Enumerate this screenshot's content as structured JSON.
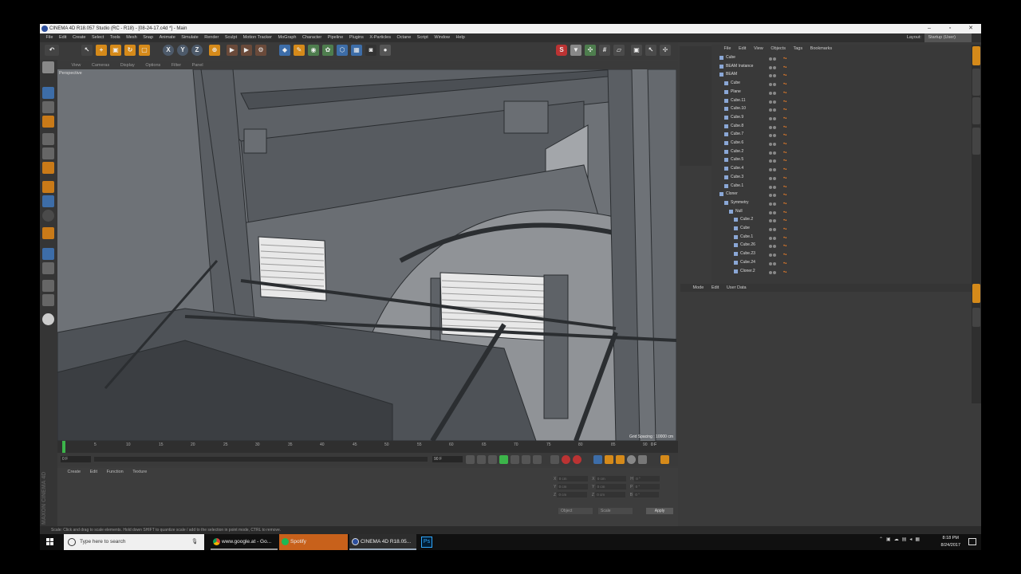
{
  "window": {
    "title": "CINEMA 4D R18.057 Studio (RC - R18) - [08-24-17.c4d *] - Main",
    "controls": [
      "–",
      "▫",
      "✕"
    ]
  },
  "menubar": {
    "items": [
      "File",
      "Edit",
      "Create",
      "Select",
      "Tools",
      "Mesh",
      "Snap",
      "Animate",
      "Simulate",
      "Render",
      "Sculpt",
      "Motion Tracker",
      "MoGraph",
      "Character",
      "Pipeline",
      "Plugins",
      "X-Particles",
      "Octane",
      "Script",
      "Window",
      "Help"
    ],
    "layout_label": "Layout:",
    "layout_value": "Startup (User)"
  },
  "toolbar": {
    "axis_labels": [
      "X",
      "Y",
      "Z"
    ]
  },
  "viewport": {
    "menu": [
      "View",
      "Cameras",
      "Display",
      "Options",
      "Filter",
      "Panel"
    ],
    "label": "Perspective",
    "grid_spacing": "Grid Spacing : 10000 cm"
  },
  "timeline": {
    "ticks": [
      "0",
      "5",
      "10",
      "15",
      "20",
      "25",
      "30",
      "35",
      "40",
      "45",
      "50",
      "55",
      "60",
      "65",
      "70",
      "75",
      "80",
      "85",
      "90"
    ],
    "current_frame": "0 F",
    "end_frame": "90 F",
    "frame_indicator": "0 F"
  },
  "material_manager": {
    "menu": [
      "Create",
      "Edit",
      "Function",
      "Texture"
    ]
  },
  "logo": {
    "text": "MAXON CINEMA 4D"
  },
  "coordinates": {
    "rows": [
      {
        "a": "X",
        "v1": "0 cm",
        "b": "X",
        "v2": "0 cm",
        "c": "H",
        "v3": "0 °"
      },
      {
        "a": "Y",
        "v1": "0 cm",
        "b": "Y",
        "v2": "0 cm",
        "c": "P",
        "v3": "0 °"
      },
      {
        "a": "Z",
        "v1": "0 cm",
        "b": "Z",
        "v2": "0 cm",
        "c": "B",
        "v3": "0 °"
      }
    ],
    "mode1": "Object",
    "mode2": "Scale",
    "apply": "Apply"
  },
  "statusbar": {
    "text": "Scale: Click and drag to scale elements. Hold down SHIFT to quantize scale / add to the selection in point mode, CTRL to remove."
  },
  "object_manager": {
    "menu": [
      "File",
      "Edit",
      "View",
      "Objects",
      "Tags",
      "Bookmarks"
    ],
    "objects": [
      {
        "name": "Cube",
        "indent": 1
      },
      {
        "name": "BEAM Instance",
        "indent": 1
      },
      {
        "name": "BEAM",
        "indent": 1
      },
      {
        "name": "Cube",
        "indent": 2
      },
      {
        "name": "Plane",
        "indent": 2
      },
      {
        "name": "Cube.11",
        "indent": 2
      },
      {
        "name": "Cube.10",
        "indent": 2
      },
      {
        "name": "Cube.9",
        "indent": 2
      },
      {
        "name": "Cube.8",
        "indent": 2
      },
      {
        "name": "Cube.7",
        "indent": 2
      },
      {
        "name": "Cube.6",
        "indent": 2
      },
      {
        "name": "Cube.2",
        "indent": 2
      },
      {
        "name": "Cube.5",
        "indent": 2
      },
      {
        "name": "Cube.4",
        "indent": 2
      },
      {
        "name": "Cube.3",
        "indent": 2
      },
      {
        "name": "Cube.1",
        "indent": 2
      },
      {
        "name": "Cloner",
        "indent": 1
      },
      {
        "name": "Symmetry",
        "indent": 2
      },
      {
        "name": "Null",
        "indent": 3
      },
      {
        "name": "Cube.2",
        "indent": 4
      },
      {
        "name": "Cube",
        "indent": 4
      },
      {
        "name": "Cube.1",
        "indent": 4
      },
      {
        "name": "Cube.26",
        "indent": 4
      },
      {
        "name": "Cube.23",
        "indent": 4
      },
      {
        "name": "Cube.24",
        "indent": 4
      },
      {
        "name": "Cloner.2",
        "indent": 4
      }
    ]
  },
  "attribute_manager": {
    "menu": [
      "Mode",
      "Edit",
      "User Data"
    ]
  },
  "taskbar": {
    "search_placeholder": "Type here to search",
    "tasks": [
      "www.google.at - Go...",
      "Spotify",
      "CINEMA 4D R18.05..."
    ],
    "time": "8:18 PM",
    "date": "8/24/2017"
  }
}
